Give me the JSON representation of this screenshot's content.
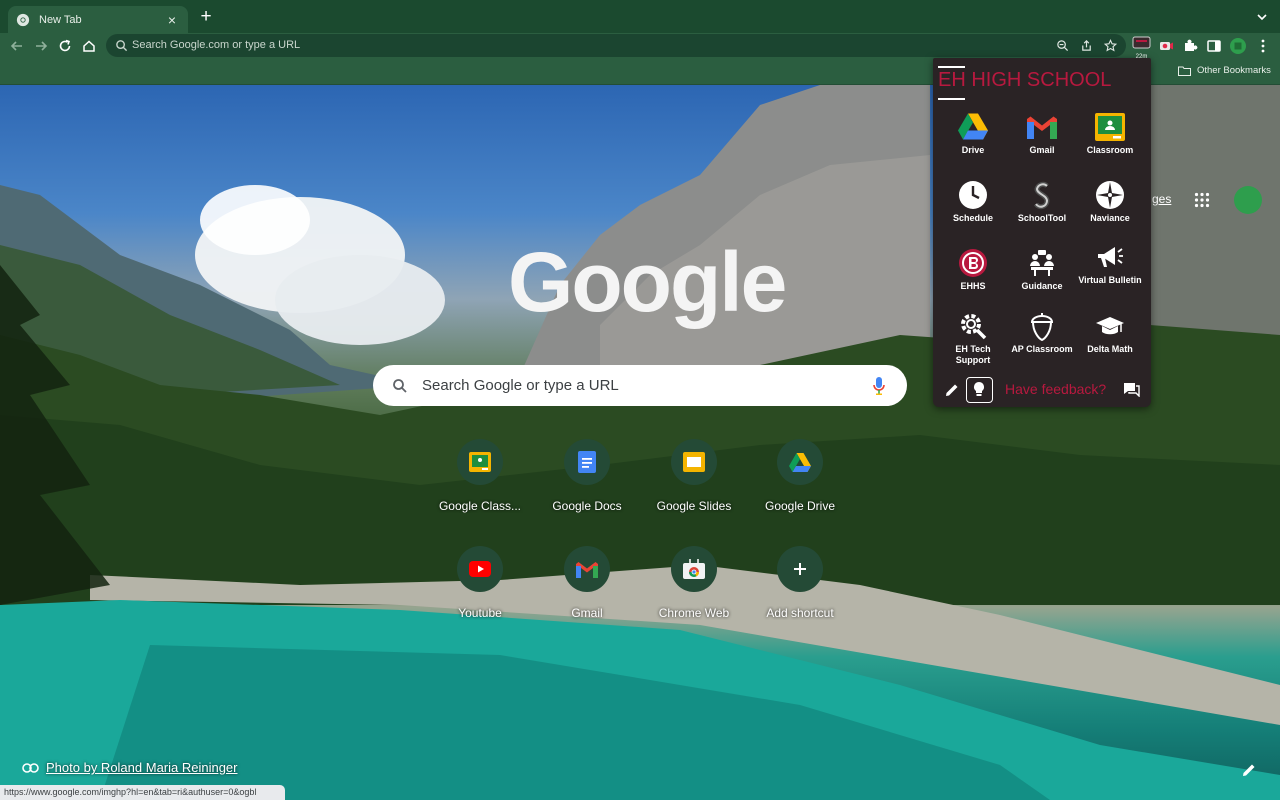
{
  "browser": {
    "tab_title": "New Tab",
    "tab_close": "×",
    "new_tab": "+",
    "omnibox_placeholder": "Search Google.com or type a URL",
    "ext_badge": "22m",
    "other_bookmarks": "Other Bookmarks"
  },
  "ntp": {
    "logo": "Google",
    "search_placeholder": "Search Google or type a URL",
    "images_link": "ges",
    "shortcuts": [
      {
        "label": "Google Class...",
        "icon": "google-classroom-icon"
      },
      {
        "label": "Google Docs",
        "icon": "google-docs-icon"
      },
      {
        "label": "Google Slides",
        "icon": "google-slides-icon"
      },
      {
        "label": "Google Drive",
        "icon": "google-drive-icon"
      },
      {
        "label": "Youtube",
        "icon": "youtube-icon"
      },
      {
        "label": "Gmail",
        "icon": "gmail-icon"
      },
      {
        "label": "Chrome Web",
        "icon": "chrome-web-store-icon"
      },
      {
        "label": "Add shortcut",
        "icon": "plus-icon"
      }
    ],
    "photo_credit": "Photo by Roland Maria Reininger",
    "status_url": "https://www.google.com/imghp?hl=en&tab=ri&authuser=0&ogbl"
  },
  "popup": {
    "title_prefix": "EH",
    "title_rest": " HIGH SCHOOL",
    "accent_color": "#b8193f",
    "items": [
      {
        "label": "Drive",
        "icon": "drive-icon"
      },
      {
        "label": "Gmail",
        "icon": "gmail-icon"
      },
      {
        "label": "Classroom",
        "icon": "classroom-icon"
      },
      {
        "label": "Schedule",
        "icon": "clock-icon"
      },
      {
        "label": "SchoolTool",
        "icon": "schooltool-icon"
      },
      {
        "label": "Naviance",
        "icon": "compass-icon"
      },
      {
        "label": "EHHS",
        "icon": "ehhs-logo-icon"
      },
      {
        "label": "Guidance",
        "icon": "guidance-icon"
      },
      {
        "label": "Virtual Bulletin",
        "icon": "megaphone-icon"
      },
      {
        "label": "EH Tech Support",
        "icon": "tech-gear-icon"
      },
      {
        "label": "AP Classroom",
        "icon": "ap-acorn-icon"
      },
      {
        "label": "Delta Math",
        "icon": "graduation-cap-icon"
      }
    ],
    "feedback": "Have feedback?"
  }
}
